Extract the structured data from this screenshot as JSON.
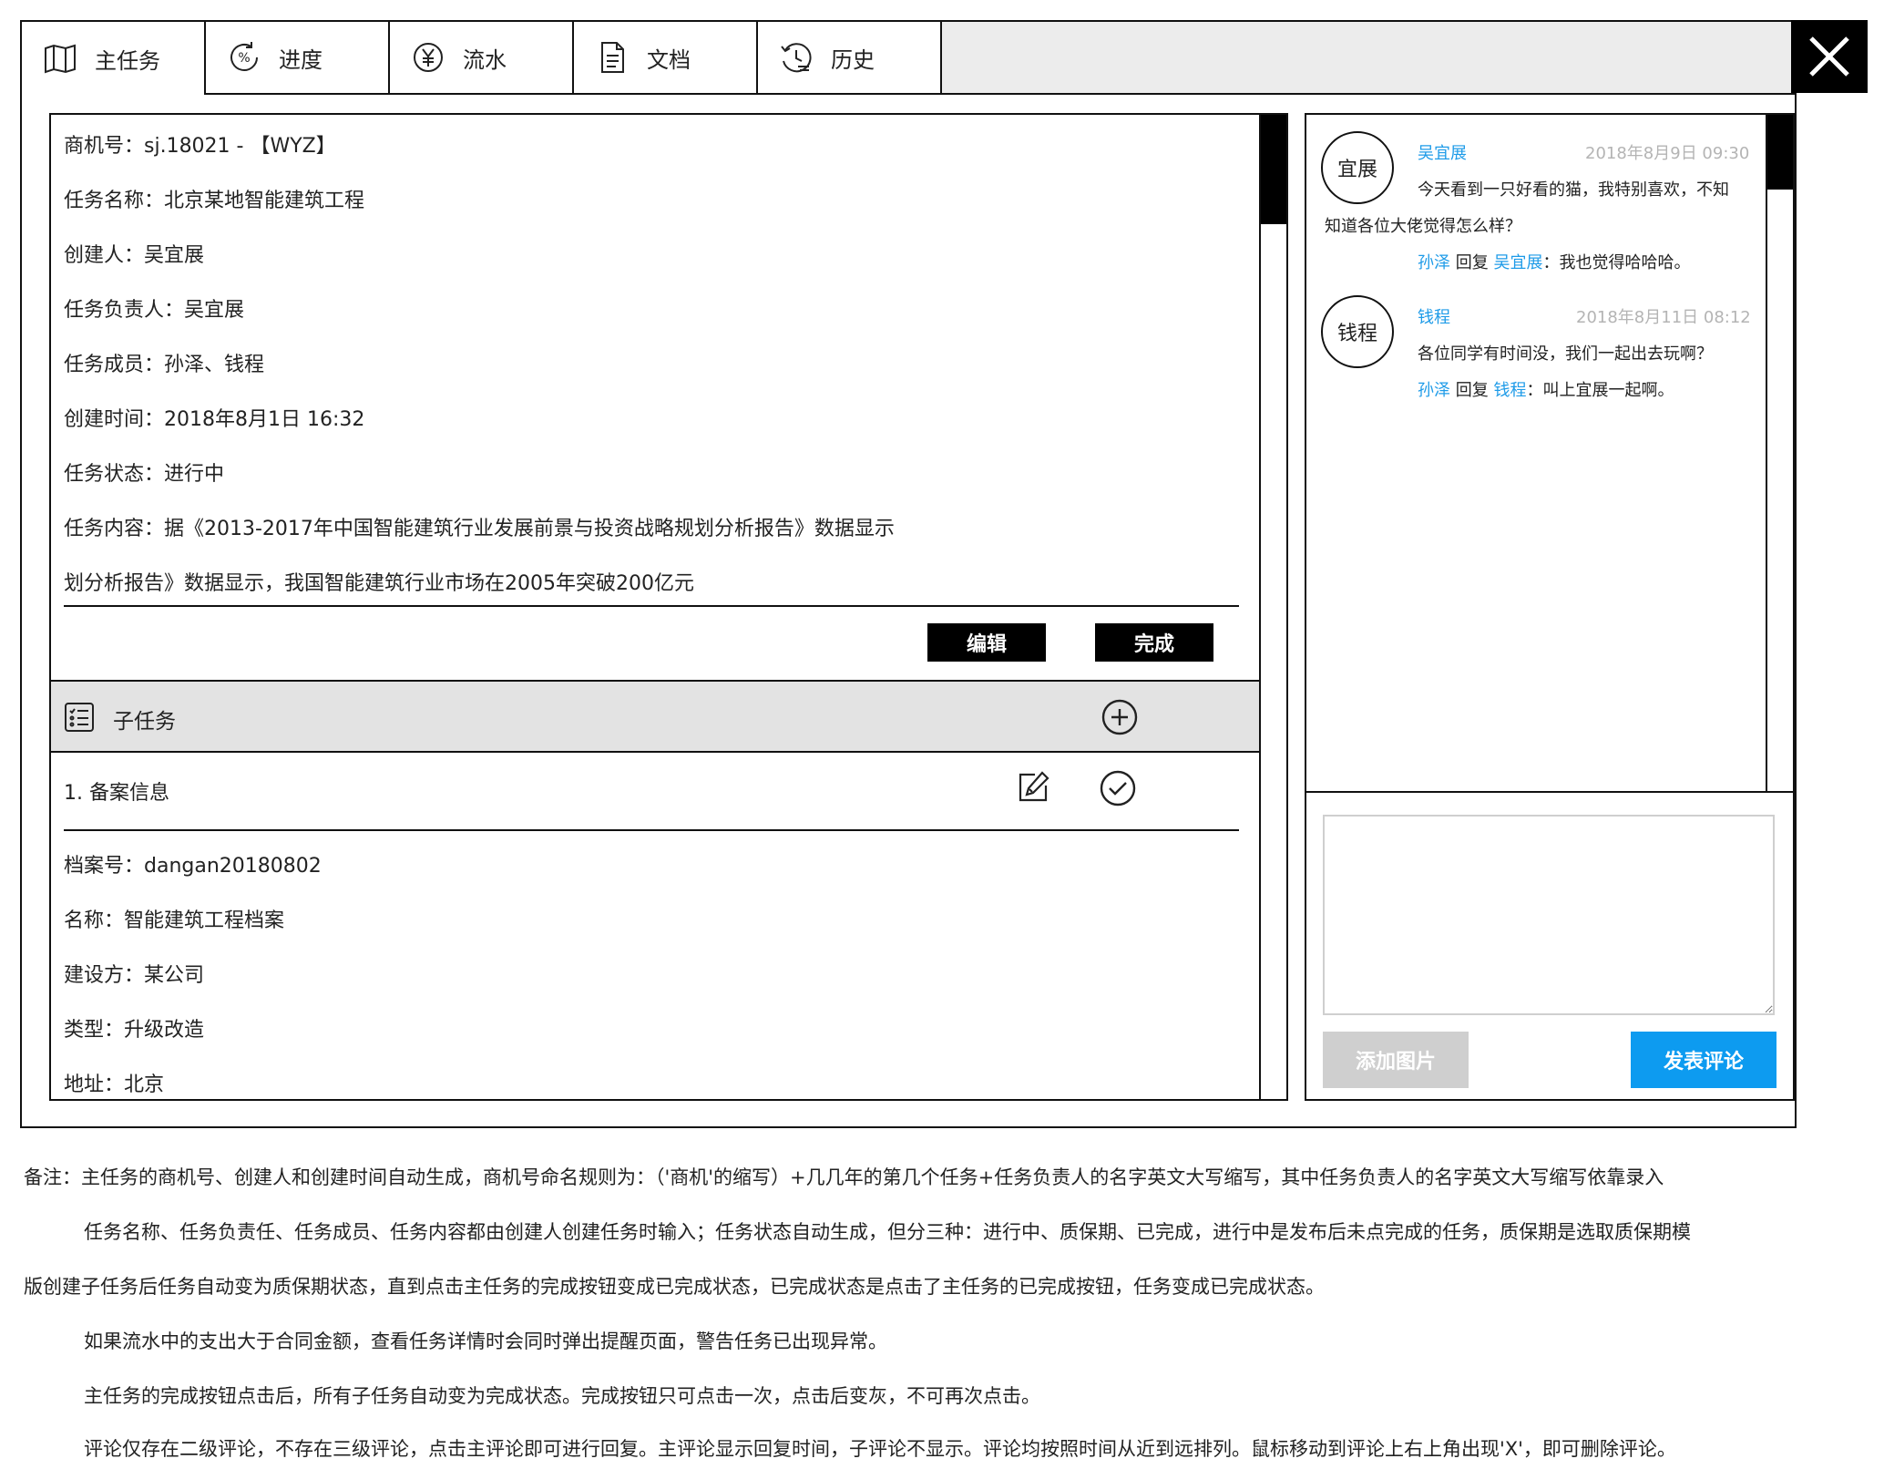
{
  "tabs": [
    {
      "label": "主任务",
      "icon": "map-icon"
    },
    {
      "label": "进度",
      "icon": "percent-cycle-icon"
    },
    {
      "label": "流水",
      "icon": "yuan-icon"
    },
    {
      "label": "文档",
      "icon": "document-icon"
    },
    {
      "label": "历史",
      "icon": "history-icon"
    }
  ],
  "main_task": {
    "lines": [
      "商机号：sj.18021 - 【WYZ】",
      "任务名称：北京某地智能建筑工程",
      "创建人：吴宜展",
      "任务负责人：吴宜展",
      "任务成员：孙泽、钱程",
      "创建时间：2018年8月1日 16:32",
      "任务状态：进行中",
      "任务内容：据《2013-2017年中国智能建筑行业发展前景与投资战略规划分析报告》数据显示",
      "划分析报告》数据显示，我国智能建筑行业市场在2005年突破200亿元"
    ],
    "edit_label": "编辑",
    "complete_label": "完成"
  },
  "subtasks": {
    "title": "子任务",
    "item_title": "1. 备案信息",
    "details": [
      "档案号：dangan20180802",
      "名称：智能建筑工程档案",
      "建设方：某公司",
      "类型：升级改造",
      "地址：北京"
    ]
  },
  "comments": [
    {
      "avatar": "宜展",
      "name": "吴宜展",
      "time": "2018年8月9日 09:30",
      "text1": "今天看到一只好看的猫，我特别喜欢，不知",
      "text2": "知道各位大佬觉得怎么样？",
      "reply_from": "孙泽",
      "reply_word": "回复",
      "reply_to": "吴宜展",
      "reply_text": "：我也觉得哈哈哈。"
    },
    {
      "avatar": "钱程",
      "name": "钱程",
      "time": "2018年8月11日 08:12",
      "text1": "各位同学有时间没，我们一起出去玩啊？",
      "reply_from": "孙泽",
      "reply_word": "回复",
      "reply_to": "钱程",
      "reply_text": "：叫上宜展一起啊。"
    }
  ],
  "comment_input": {
    "value": "",
    "placeholder": ""
  },
  "add_image_label": "添加图片",
  "post_comment_label": "发表评论",
  "notes": [
    "备注：主任务的商机号、创建人和创建时间自动生成，商机号命名规则为：（'商机'的缩写）+几几年的第几个任务+任务负责人的名字英文大写缩写，其中任务负责人的名字英文大写缩写依靠录入",
    "任务名称、任务负责任、任务成员、任务内容都由创建人创建任务时输入；任务状态自动生成，但分三种：进行中、质保期、已完成，进行中是发布后未点完成的任务，质保期是选取质保期模",
    "版创建子任务后任务自动变为质保期状态，直到点击主任务的完成按钮变成已完成状态，已完成状态是点击了主任务的已完成按钮，任务变成已完成状态。",
    "如果流水中的支出大于合同金额，查看任务详情时会同时弹出提醒页面，警告任务已出现异常。",
    "主任务的完成按钮点击后，所有子任务自动变为完成状态。完成按钮只可点击一次，点击后变灰，不可再次点击。",
    "评论仅存在二级评论，不存在三级评论，点击主评论即可进行回复。主评论显示回复时间，子评论不显示。评论均按照时间从近到远排列。鼠标移动到评论上右上角出现'X'，即可删除评论。"
  ],
  "colors": {
    "accent": "#0d9bf0",
    "link": "#1e9be8",
    "muted": "#b4b4b4",
    "disabled": "#cfcfcf"
  }
}
